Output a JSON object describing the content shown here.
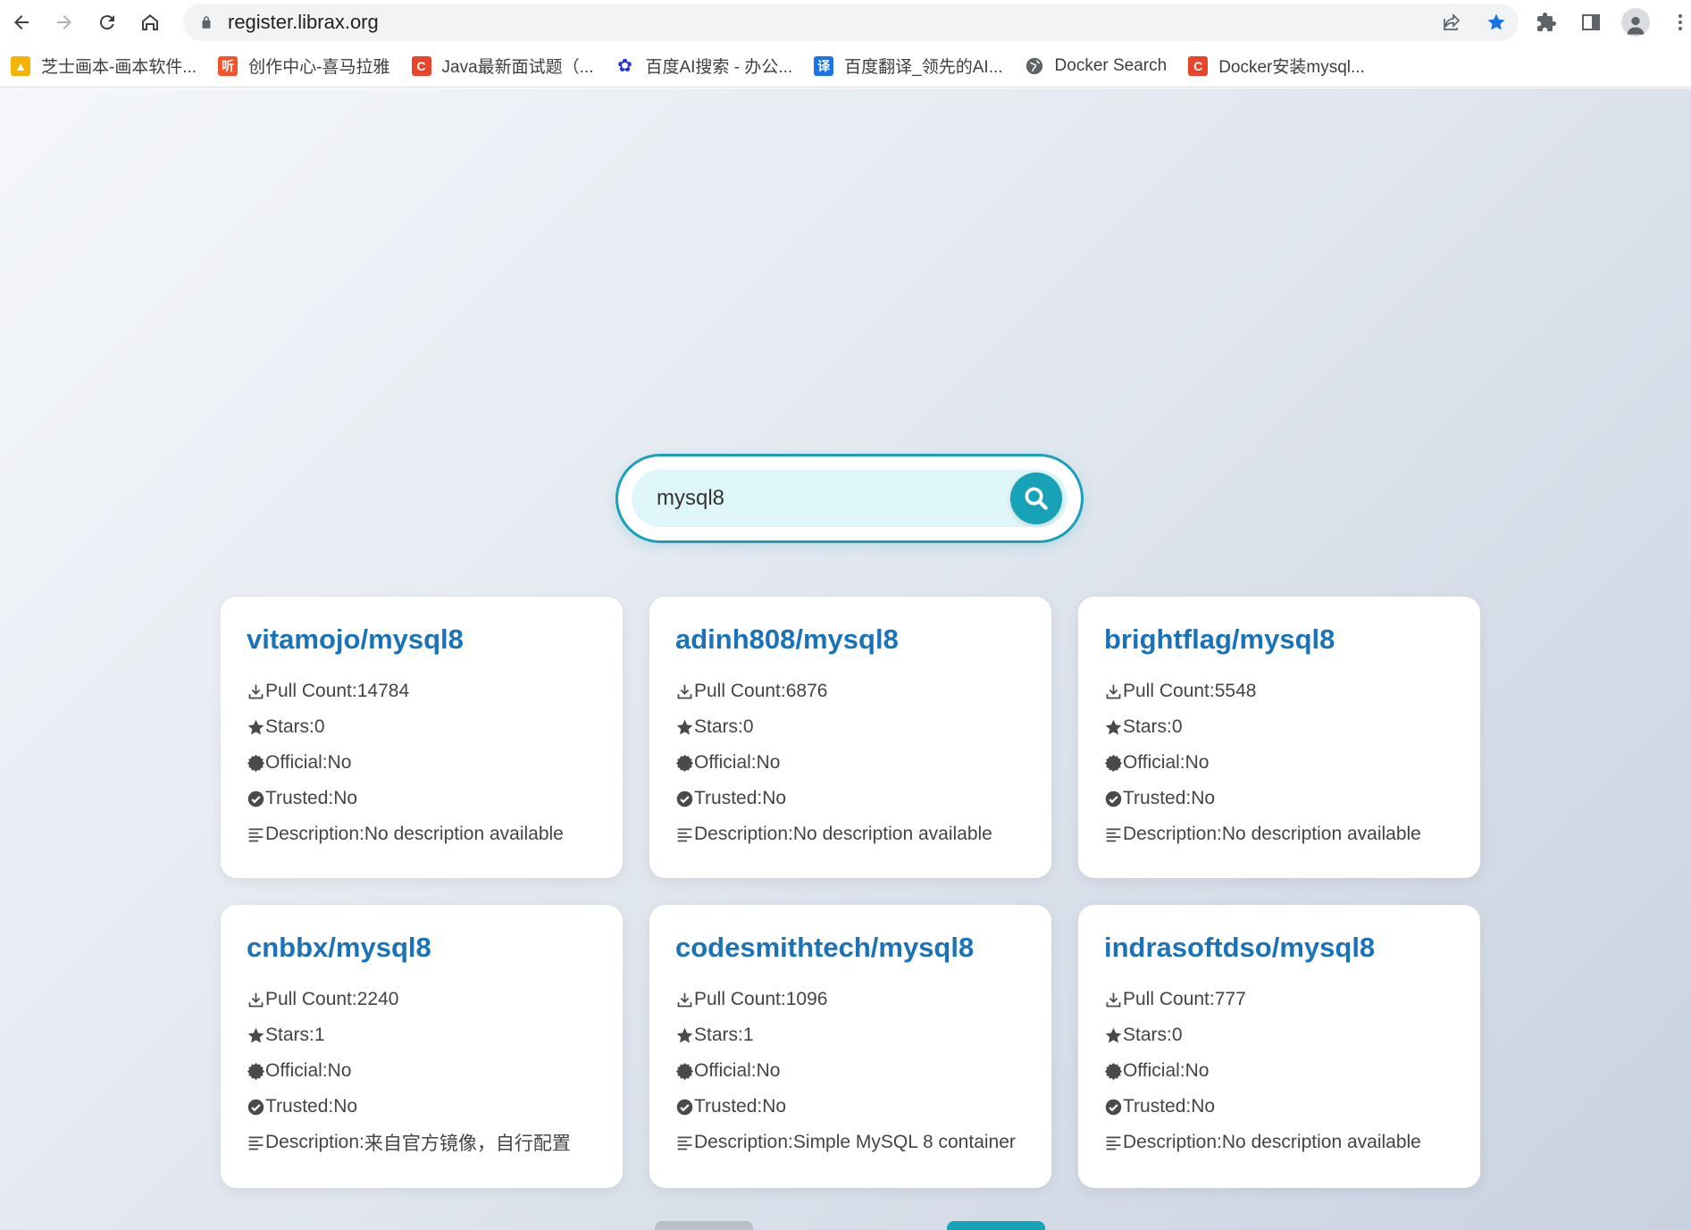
{
  "browser": {
    "url": "register.librax.org",
    "bookmarks": [
      {
        "label": "芝士画本-画本软件...",
        "icon": "cheese-icon",
        "color": "#f4b400"
      },
      {
        "label": "创作中心-喜马拉雅",
        "icon": "ximalaya-icon",
        "color": "#f2552c"
      },
      {
        "label": "Java最新面试题（...",
        "icon": "csdn-icon",
        "color": "#e8452c"
      },
      {
        "label": "百度AI搜索 - 办公...",
        "icon": "baidu-icon",
        "color": "#2932e1"
      },
      {
        "label": "百度翻译_领先的AI...",
        "icon": "translate-icon",
        "color": "#1a73e8"
      },
      {
        "label": "Docker Search",
        "icon": "globe-icon",
        "color": "#5f6368"
      },
      {
        "label": "Docker安装mysql...",
        "icon": "csdn-icon",
        "color": "#e8452c"
      }
    ]
  },
  "search": {
    "value": "mysql8"
  },
  "labels": {
    "pull_count": "Pull Count: ",
    "stars": "Stars: ",
    "official": "Official: ",
    "trusted": "Trusted: ",
    "description": "Description: "
  },
  "results": [
    {
      "name": "vitamojo/mysql8",
      "pull_count": "14784",
      "stars": "0",
      "official": "No",
      "trusted": "No",
      "description": "No description available"
    },
    {
      "name": "adinh808/mysql8",
      "pull_count": "6876",
      "stars": "0",
      "official": "No",
      "trusted": "No",
      "description": "No description available"
    },
    {
      "name": "brightflag/mysql8",
      "pull_count": "5548",
      "stars": "0",
      "official": "No",
      "trusted": "No",
      "description": "No description available"
    },
    {
      "name": "cnbbx/mysql8",
      "pull_count": "2240",
      "stars": "1",
      "official": "No",
      "trusted": "No",
      "description": "来自官方镜像，自行配置"
    },
    {
      "name": "codesmithtech/mysql8",
      "pull_count": "1096",
      "stars": "1",
      "official": "No",
      "trusted": "No",
      "description": "Simple MySQL 8 container"
    },
    {
      "name": "indrasoftdso/mysql8",
      "pull_count": "777",
      "stars": "0",
      "official": "No",
      "trusted": "No",
      "description": "No description available"
    }
  ],
  "colors": {
    "accent": "#17a2b8",
    "title_link": "#1a73b8"
  }
}
